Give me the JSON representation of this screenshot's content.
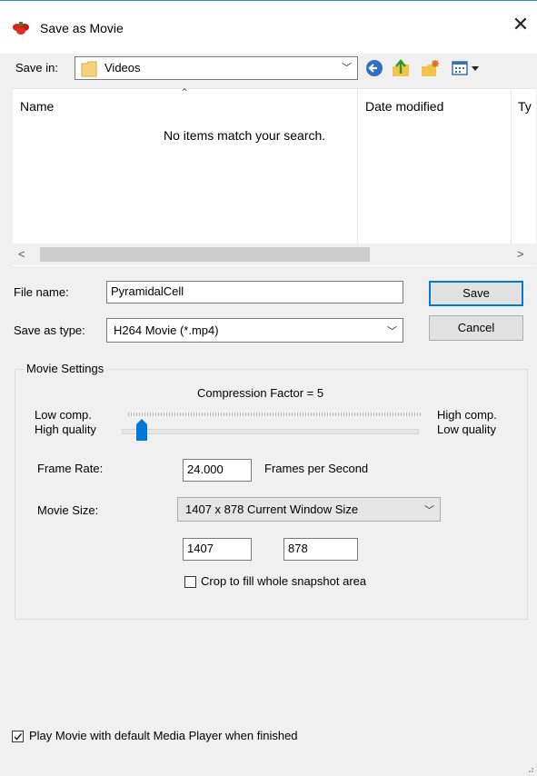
{
  "window": {
    "title": "Save as Movie",
    "close_glyph": "✕",
    "app_icon": "app-flower-icon"
  },
  "save_in": {
    "label": "Save in:",
    "folder": "Videos",
    "folder_icon": "folder-icon"
  },
  "toolbar": {
    "back_icon": "back-arrow-icon",
    "up_icon": "up-folder-icon",
    "new_folder_icon": "new-folder-icon",
    "views_icon": "view-menu-icon"
  },
  "file_list": {
    "columns": [
      "Name",
      "Date modified",
      "Ty"
    ],
    "empty_message": "No items match your search."
  },
  "file_name": {
    "label": "File name:",
    "value": "PyramidalCell"
  },
  "save_type": {
    "label": "Save as type:",
    "value": "H264 Movie (*.mp4)"
  },
  "buttons": {
    "save": "Save",
    "cancel": "Cancel"
  },
  "movie_settings": {
    "group_label": "Movie Settings",
    "compression_label": "Compression Factor = 5",
    "compression_value": 5,
    "low_comp": "Low comp.",
    "high_quality": "High quality",
    "high_comp": "High comp.",
    "low_quality": "Low quality",
    "frame_rate_label": "Frame Rate:",
    "frame_rate_value": "24.000",
    "frame_rate_unit": "Frames per Second",
    "movie_size_label": "Movie Size:",
    "movie_size_value": "1407 x 878 Current Window Size",
    "width": "1407",
    "height": "878",
    "crop_label": "Crop to fill whole snapshot area",
    "crop_checked": false
  },
  "play_movie": {
    "label": "Play Movie with default Media Player when finished",
    "checked": true
  },
  "colors": {
    "accent": "#0078d7",
    "title_line": "#2b8ae0"
  }
}
